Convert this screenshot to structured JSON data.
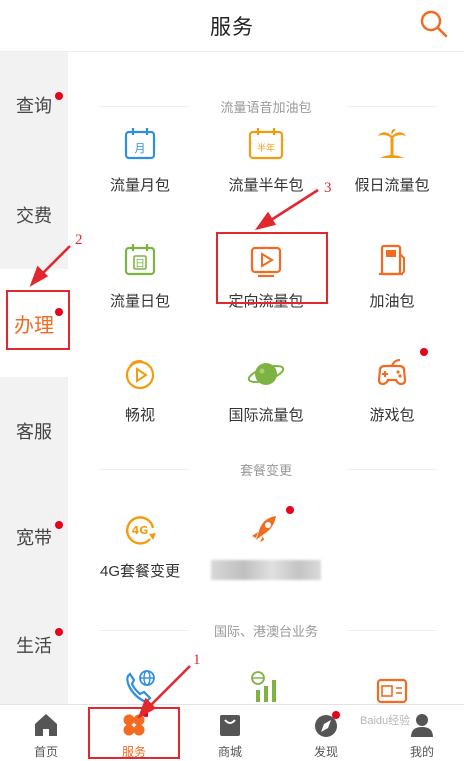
{
  "header": {
    "title": "服务"
  },
  "sidebar": {
    "items": [
      {
        "label": "查询",
        "dot": true,
        "active": false
      },
      {
        "label": "交费",
        "dot": false,
        "active": false
      },
      {
        "label": "办理",
        "dot": true,
        "active": true
      },
      {
        "label": "客服",
        "dot": false,
        "active": false
      },
      {
        "label": "宽带",
        "dot": true,
        "active": false
      },
      {
        "label": "生活",
        "dot": true,
        "active": false
      }
    ]
  },
  "sections": [
    {
      "title": "流量语音加油包",
      "items": [
        {
          "label": "流量月包",
          "icon": "calendar-month-icon",
          "badge": "月"
        },
        {
          "label": "流量半年包",
          "icon": "calendar-halfyear-icon",
          "badge": "半年"
        },
        {
          "label": "假日流量包",
          "icon": "palm-tree-icon"
        },
        {
          "label": "流量日包",
          "icon": "calendar-day-icon",
          "badge": "日"
        },
        {
          "label": "定向流量包",
          "icon": "play-icon"
        },
        {
          "label": "加油包",
          "icon": "fuel-pump-icon"
        },
        {
          "label": "畅视",
          "icon": "video-play-icon"
        },
        {
          "label": "国际流量包",
          "icon": "planet-icon"
        },
        {
          "label": "游戏包",
          "icon": "gamepad-icon",
          "dot": true
        }
      ]
    },
    {
      "title": "套餐变更",
      "items": [
        {
          "label": "4G套餐变更",
          "icon": "4g-refresh-icon",
          "badge": "4G"
        },
        {
          "label": "",
          "icon": "rocket-icon",
          "dot": true
        }
      ]
    },
    {
      "title": "国际、港澳台业务",
      "items": [
        {
          "label": "",
          "icon": "globe-phone-icon"
        },
        {
          "label": "",
          "icon": "signal-bars-icon"
        },
        {
          "label": "",
          "icon": "wallet-card-icon"
        }
      ]
    }
  ],
  "tabbar": {
    "items": [
      {
        "label": "首页",
        "icon": "home-icon",
        "active": false
      },
      {
        "label": "服务",
        "icon": "clover-icon",
        "active": true
      },
      {
        "label": "商城",
        "icon": "shopping-bag-icon",
        "active": false
      },
      {
        "label": "发现",
        "icon": "compass-icon",
        "active": false
      },
      {
        "label": "我的",
        "icon": "user-icon",
        "active": false
      }
    ]
  },
  "annotations": {
    "c1": "1",
    "c2": "2",
    "c3": "3"
  },
  "watermark": "Baidu经验",
  "colors": {
    "accent": "#f26b21",
    "icon_orange": "#f39c12",
    "icon_green": "#7cb342",
    "icon_blue": "#2f8fdd",
    "badge_red": "#e8001c",
    "annotation_red": "#e0282e"
  }
}
